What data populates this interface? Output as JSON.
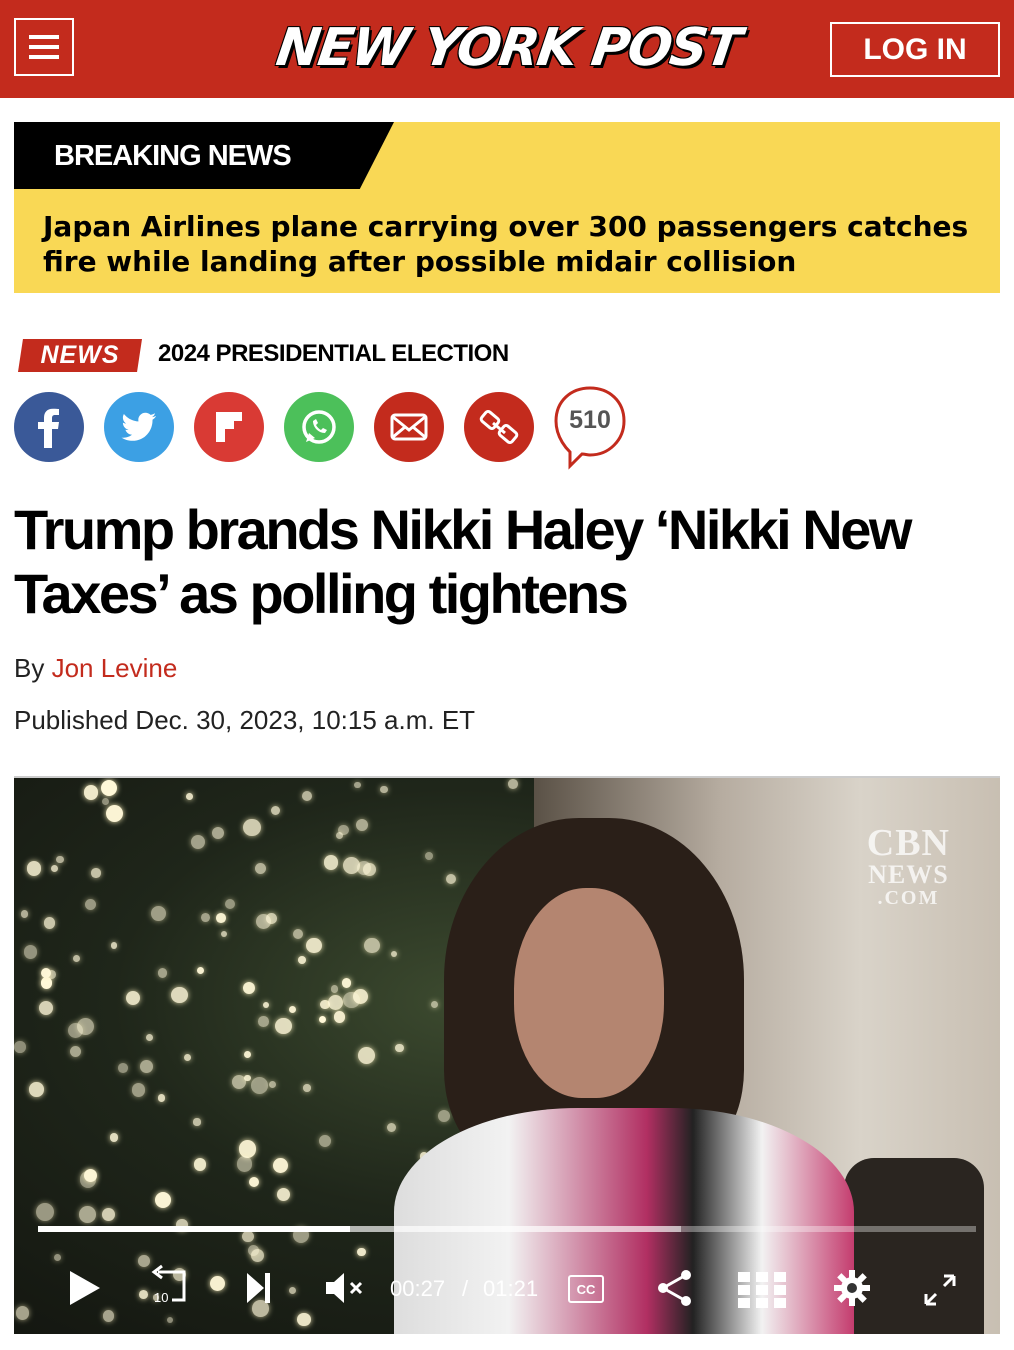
{
  "header": {
    "logo": "NEW YORK POST",
    "login_label": "LOG IN",
    "menu_icon": "hamburger-menu-icon"
  },
  "breaking": {
    "label": "BREAKING NEWS",
    "headline": "Japan Airlines plane carrying over 300 passengers catches fire while landing after possible midair collision"
  },
  "section": {
    "tag": "NEWS",
    "topic": "2024 PRESIDENTIAL ELECTION"
  },
  "share": {
    "icons": [
      "facebook-icon",
      "twitter-icon",
      "flipboard-icon",
      "whatsapp-icon",
      "email-icon",
      "link-icon"
    ],
    "comment_count": "510",
    "colors": {
      "facebook": "#3a5998",
      "twitter": "#3ca0e4",
      "flipboard": "#d93a34",
      "whatsapp": "#4cc05a",
      "email": "#c32b1d",
      "link": "#c32b1d"
    }
  },
  "article": {
    "title": "Trump brands Nikki Haley ‘Nikki New Taxes’ as polling tightens",
    "by_prefix": "By",
    "author": "Jon Levine",
    "published": "Published Dec. 30, 2023, 10:15 a.m. ET"
  },
  "video": {
    "watermark_top": "CBN",
    "watermark_mid": "NEWS",
    "watermark_bottom": ".COM",
    "current_time": "00:27",
    "separator": "/",
    "duration": "01:21",
    "progress_fraction": 0.333,
    "buffered_fraction": 0.685,
    "cc_label": "CC",
    "skip_seconds": "10"
  },
  "colors": {
    "brand_red": "#c32b1d",
    "breaking_yellow": "#f9d855"
  }
}
